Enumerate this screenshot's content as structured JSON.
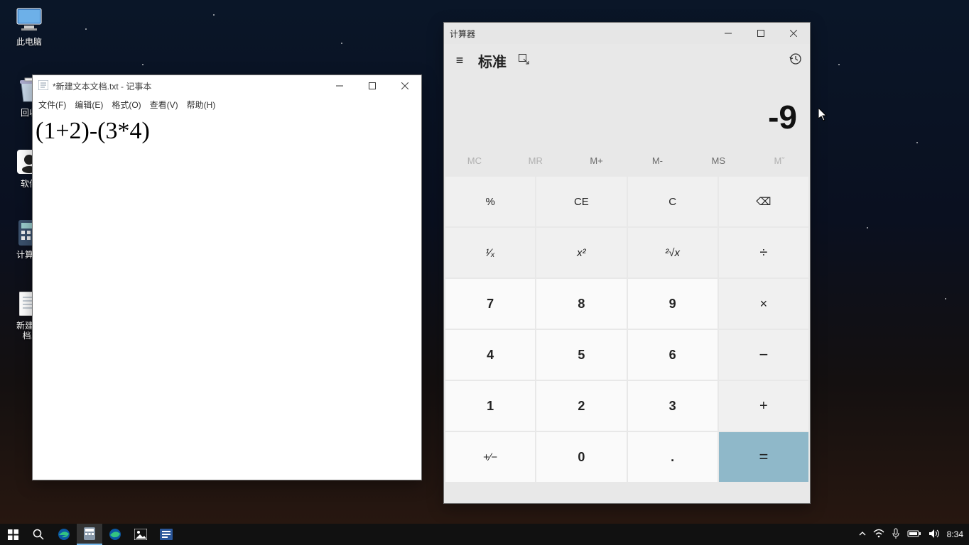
{
  "desktop": {
    "icons": [
      {
        "label": "此电脑"
      },
      {
        "label": "回收"
      },
      {
        "label": "软件"
      },
      {
        "label": "计算器"
      },
      {
        "label": "新建文\n档.t"
      }
    ]
  },
  "notepad": {
    "title": "*新建文本文档.txt - 记事本",
    "menus": [
      "文件(F)",
      "编辑(E)",
      "格式(O)",
      "查看(V)",
      "帮助(H)"
    ],
    "content": "(1+2)-(3*4)"
  },
  "calc": {
    "title": "计算器",
    "mode": "标准",
    "display": "-9",
    "memory": {
      "mc": "MC",
      "mr": "MR",
      "mplus": "M+",
      "mminus": "M-",
      "ms": "MS",
      "mlist": "Mˇ"
    },
    "keys": {
      "percent": "%",
      "ce": "CE",
      "c": "C",
      "back": "⌫",
      "recip": "¹∕ₓ",
      "square": "x²",
      "sqrt": "²√x",
      "divide": "÷",
      "k7": "7",
      "k8": "8",
      "k9": "9",
      "multiply": "×",
      "k4": "4",
      "k5": "5",
      "k6": "6",
      "minus": "−",
      "k1": "1",
      "k2": "2",
      "k3": "3",
      "plus": "+",
      "negate": "+∕−",
      "k0": "0",
      "dot": ".",
      "equals": "="
    }
  },
  "taskbar": {
    "time": "8:34"
  }
}
